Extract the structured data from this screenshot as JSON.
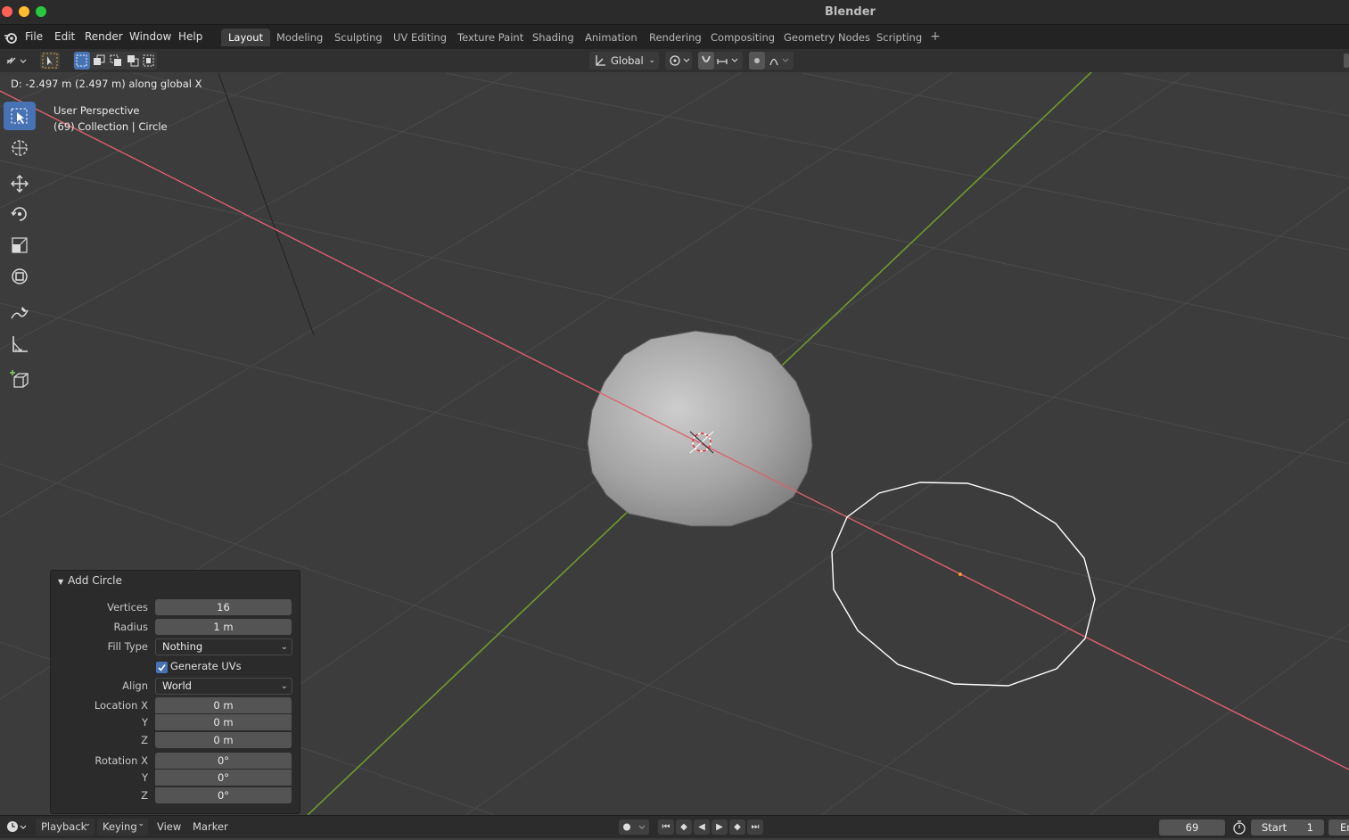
{
  "window": {
    "title": "Blender"
  },
  "menu": {
    "items": [
      "File",
      "Edit",
      "Render",
      "Window",
      "Help"
    ]
  },
  "workspaces": {
    "tabs": [
      "Layout",
      "Modeling",
      "Sculpting",
      "UV Editing",
      "Texture Paint",
      "Shading",
      "Animation",
      "Rendering",
      "Compositing",
      "Geometry Nodes",
      "Scripting"
    ],
    "active": "Layout"
  },
  "header": {
    "orientation": "Global"
  },
  "viewport": {
    "status": "D: -2.497 m (2.497 m) along global X",
    "perspective": "User Perspective",
    "collection": "(69) Collection | Circle"
  },
  "operator": {
    "title": "Add Circle",
    "vertices_label": "Vertices",
    "vertices": "16",
    "radius_label": "Radius",
    "radius": "1 m",
    "fill_type_label": "Fill Type",
    "fill_type": "Nothing",
    "generate_uvs_label": "Generate UVs",
    "generate_uvs": true,
    "align_label": "Align",
    "align": "World",
    "location_x_label": "Location X",
    "location_x": "0 m",
    "location_y_label": "Y",
    "location_y": "0 m",
    "location_z_label": "Z",
    "location_z": "0 m",
    "rotation_x_label": "Rotation X",
    "rotation_x": "0°",
    "rotation_y_label": "Y",
    "rotation_y": "0°",
    "rotation_z_label": "Z",
    "rotation_z": "0°"
  },
  "timeline": {
    "playback": "Playback",
    "keying": "Keying",
    "view": "View",
    "marker": "Marker",
    "current_frame": "69",
    "start_label": "Start",
    "start": "1",
    "end_label": "En"
  },
  "colors": {
    "accent": "#4772b3",
    "x_axis": "#e06070",
    "y_axis": "#6f9a2e",
    "background": "#3c3c3c"
  },
  "icons": [
    "blender-logo-icon",
    "select-box-icon",
    "cursor-icon",
    "move-icon",
    "rotate-icon",
    "scale-icon",
    "transform-icon",
    "annotate-icon",
    "measure-icon",
    "add-cube-icon"
  ]
}
